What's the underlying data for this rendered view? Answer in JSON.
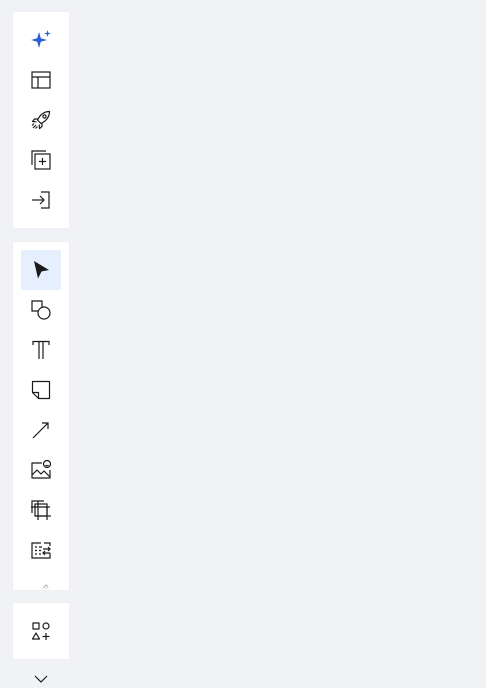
{
  "colors": {
    "background": "#f1f2f5",
    "panel": "#ffffff",
    "icon": "#1a1a1a",
    "accent": "#2b5dd1",
    "active_bg": "#e6effd"
  },
  "toolbar_top": {
    "items": [
      {
        "icon": "sparkle-icon"
      },
      {
        "icon": "template-layout-icon"
      },
      {
        "icon": "rocket-icon"
      },
      {
        "icon": "add-frame-icon"
      },
      {
        "icon": "import-icon"
      }
    ]
  },
  "toolbar_tools": {
    "selected": "select-tool",
    "items": [
      {
        "icon": "cursor-icon"
      },
      {
        "icon": "shapes-icon"
      },
      {
        "icon": "text-icon"
      },
      {
        "icon": "sticky-note-icon"
      },
      {
        "icon": "arrow-line-icon"
      },
      {
        "icon": "image-icon"
      },
      {
        "icon": "frame-icon"
      },
      {
        "icon": "list-swap-icon"
      },
      {
        "icon": "pen-icon"
      }
    ]
  },
  "toolbar_more": {
    "items": [
      {
        "icon": "more-apps-icon"
      }
    ]
  },
  "collapse": {
    "icon": "chevron-down-icon"
  }
}
